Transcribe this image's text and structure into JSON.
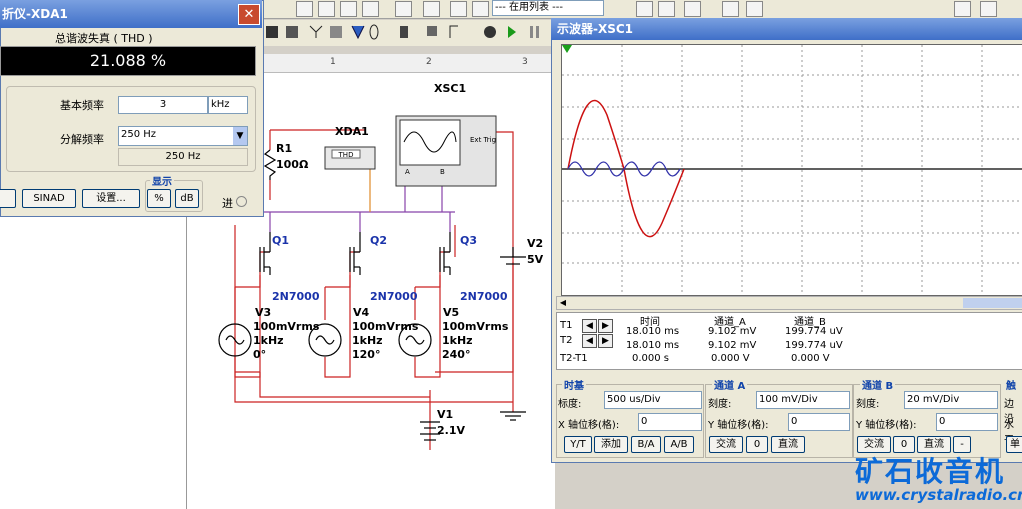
{
  "toolbar": {
    "dropdown_value": "--- 在用列表 ---",
    "dropdown_prefix": "---"
  },
  "ruler": {
    "marks": [
      "1",
      "2",
      "3"
    ]
  },
  "thd_window": {
    "title": "折仪-XDA1",
    "close_label": "✕",
    "measure_label": "总谐波失真 ( THD )",
    "reading": "21.088 %",
    "fundamental_label": "基本频率",
    "fundamental_value": "3",
    "fundamental_unit": "kHz",
    "resolution_label": "分解频率",
    "resolution_value": "250 Hz",
    "resolution_readout": "250 Hz",
    "display_group": "显示",
    "buttons": {
      "thd": "",
      "sinad": "SINAD",
      "settings": "设置...",
      "percent": "%",
      "db": "dB"
    },
    "input_label": "进"
  },
  "schematic": {
    "xsc_label": "XSC1",
    "xda_label": "XDA1",
    "thd_box_label": "THD",
    "xsc_ext_trig": "Ext Trig",
    "xsc_a": "A",
    "xsc_b": "B",
    "r1_name": "R1",
    "r1_value": "100Ω",
    "q1": "Q1",
    "q2": "Q2",
    "q3": "Q3",
    "mos": "2N7000",
    "v2_name": "V2",
    "v2_value": "5V",
    "v3_name": "V3",
    "v3_line1": "100mVrms",
    "v3_line2": "1kHz",
    "v3_line3": "0°",
    "v4_name": "V4",
    "v4_line1": "100mVrms",
    "v4_line2": "1kHz",
    "v4_line3": "120°",
    "v5_name": "V5",
    "v5_line1": "100mVrms",
    "v5_line2": "1kHz",
    "v5_line3": "240°",
    "v1_name": "V1",
    "v1_value": "2.1V"
  },
  "scope_window": {
    "title": "示波器-XSC1",
    "table_headers": {
      "time": "时间",
      "ch_a": "通道_A",
      "ch_b": "通道_B"
    },
    "rows": [
      {
        "label": "T1",
        "time": "18.010 ms",
        "ch_a": "9.102 mV",
        "ch_b": "199.774 uV"
      },
      {
        "label": "T2",
        "time": "18.010 ms",
        "ch_a": "9.102 mV",
        "ch_b": "199.774 uV"
      },
      {
        "label": "T2-T1",
        "time": "0.000 s",
        "ch_a": "0.000 V",
        "ch_b": "0.000 V"
      }
    ],
    "timebase": {
      "group": "时基",
      "scale_label": "标度:",
      "scale_value": "500 us/Div",
      "xpos_label": "X 轴位移(格):",
      "xpos_value": "0",
      "buttons": [
        "Y/T",
        "添加",
        "B/A",
        "A/B"
      ]
    },
    "channel_a": {
      "group": "通道 A",
      "scale_label": "刻度:",
      "scale_value": "100 mV/Div",
      "ypos_label": "Y 轴位移(格):",
      "ypos_value": "0",
      "buttons": [
        "交流",
        "0",
        "直流"
      ]
    },
    "channel_b": {
      "group": "通道 B",
      "scale_label": "刻度:",
      "scale_value": "20 mV/Div",
      "ypos_label": "Y 轴位移(格):",
      "ypos_value": "0",
      "buttons": [
        "交流",
        "0",
        "直流",
        "-"
      ]
    },
    "trigger": {
      "group": "触",
      "edge_label": "边沿",
      "level_label": "水平",
      "single": "单"
    },
    "trace_colors": {
      "ch_a": "#cc1111",
      "ch_b": "#3333aa"
    }
  },
  "watermark": {
    "brand": "矿石收音机",
    "url": "www.crystalradio.cn"
  }
}
